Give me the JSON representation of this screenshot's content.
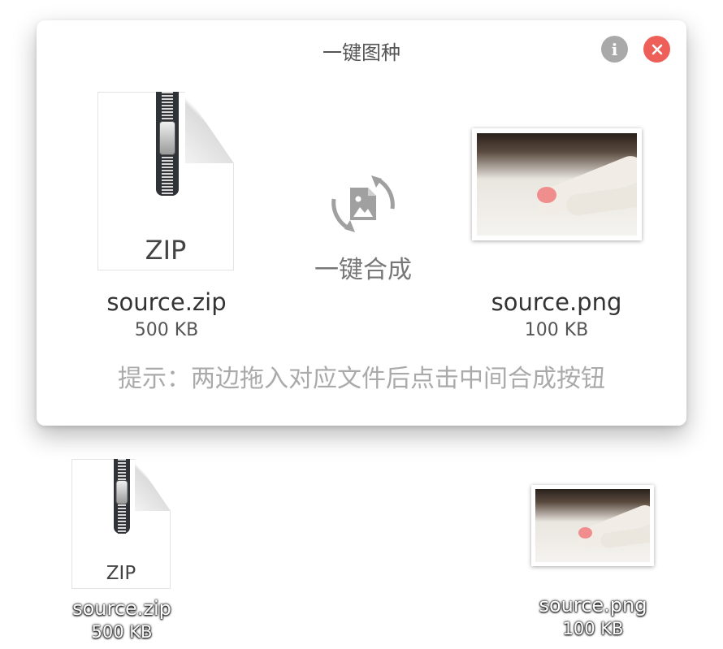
{
  "window": {
    "title": "一键图种",
    "info_icon": "info-icon",
    "close_icon": "close-icon",
    "merge_icon": "merge-image-icon",
    "merge_label": "一键合成",
    "hint": "提示：两边拖入对应文件后点击中间合成按钮",
    "left_file": {
      "type_label": "ZIP",
      "name": "source.zip",
      "size": "500 KB"
    },
    "right_file": {
      "name": "source.png",
      "size": "100 KB"
    }
  },
  "desktop": {
    "zip_file": {
      "type_label": "ZIP",
      "name": "source.zip",
      "size": "500 KB"
    },
    "png_file": {
      "name": "source.png",
      "size": "100 KB"
    }
  },
  "colors": {
    "close": "#ed5f58",
    "info": "#a9a9a9",
    "merge_icon": "#a0a0a0"
  }
}
